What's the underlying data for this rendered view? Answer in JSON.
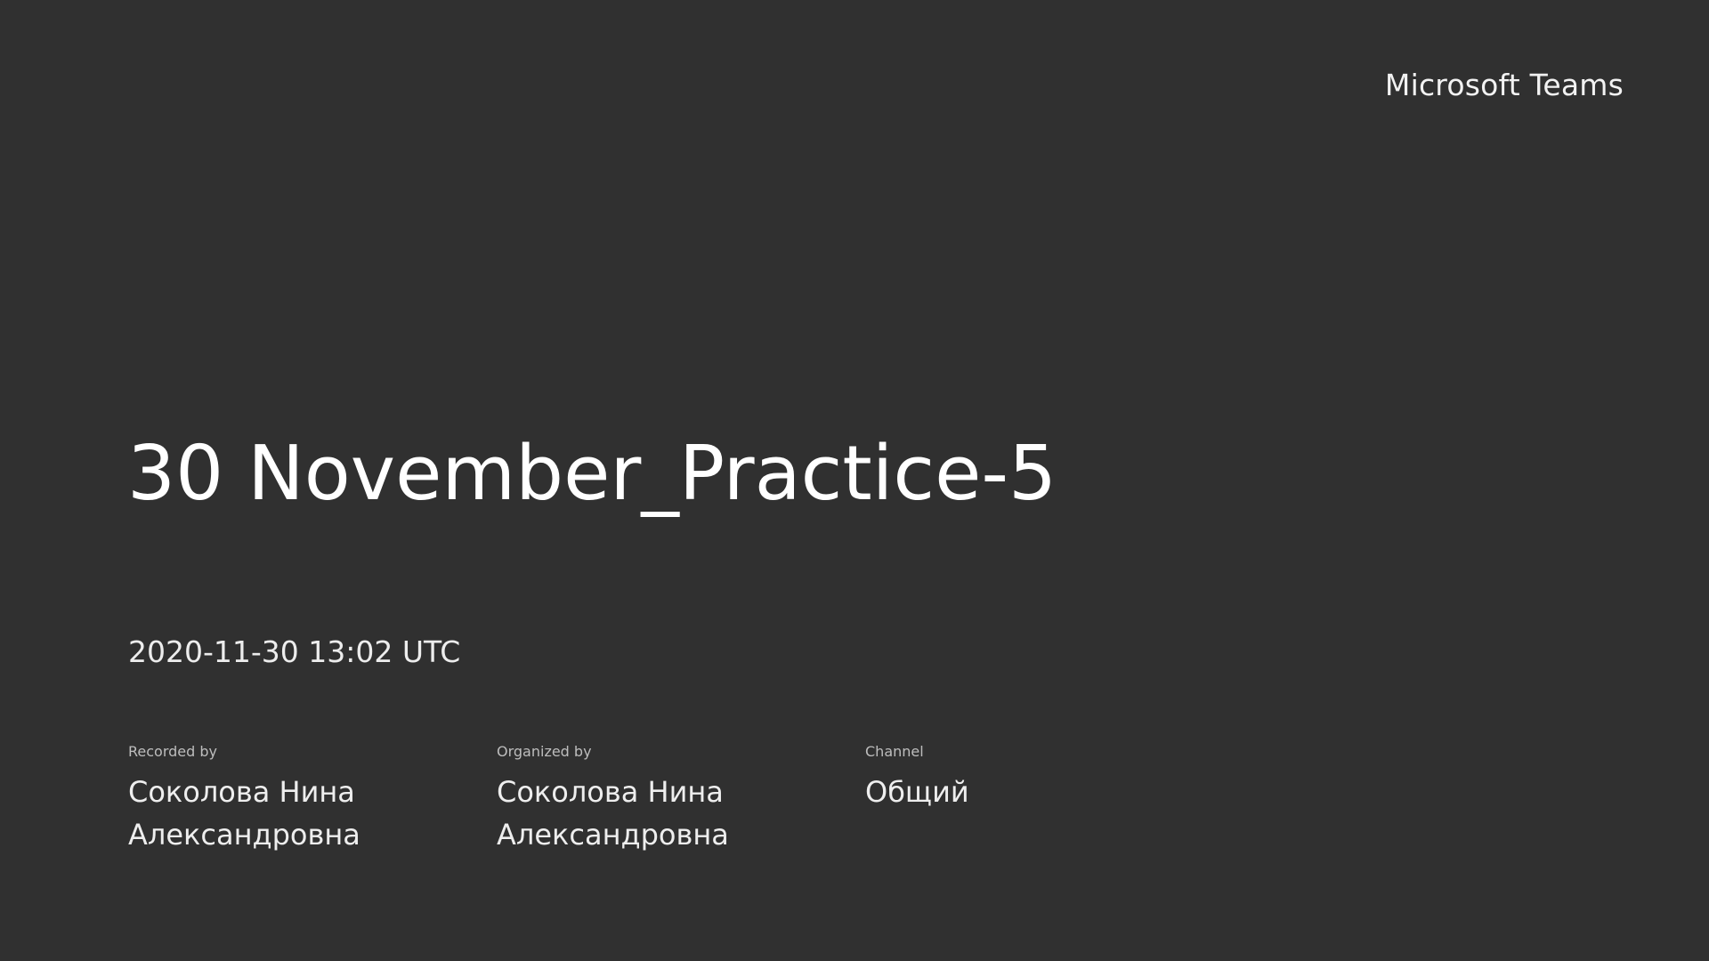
{
  "brand": {
    "name": "Microsoft Teams"
  },
  "recording": {
    "title": "30 November_Practice-5",
    "datetime": "2020-11-30 13:02 UTC"
  },
  "meta": {
    "recorded_by": {
      "label": "Recorded by",
      "value": "Соколова Нина Александровна"
    },
    "organized_by": {
      "label": "Organized by",
      "value": "Соколова Нина Александровна"
    },
    "channel": {
      "label": "Channel",
      "value": "Общий"
    }
  },
  "colors": {
    "background": "#303030",
    "text_primary": "#ffffff",
    "text_secondary": "#bdbdbd"
  }
}
